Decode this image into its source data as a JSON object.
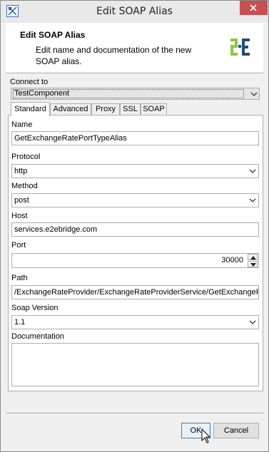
{
  "window": {
    "title": "Edit SOAP Alias",
    "icons": {
      "app": "app-icon",
      "close": "close-icon"
    },
    "close_color": "#c75050"
  },
  "header": {
    "title": "Edit SOAP Alias",
    "description": "Edit name and documentation of the new SOAP alias.",
    "logo": "e2e-logo-icon"
  },
  "connect": {
    "label": "Connect to",
    "value": "TestComponent"
  },
  "tabs": [
    {
      "label": "Standard",
      "active": true
    },
    {
      "label": "Advanced",
      "active": false
    },
    {
      "label": "Proxy",
      "active": false
    },
    {
      "label": "SSL",
      "active": false
    },
    {
      "label": "SOAP",
      "active": false
    }
  ],
  "form": {
    "name_label": "Name",
    "name_value": "GetExchangeRatePortTypeAlias",
    "protocol_label": "Protocol",
    "protocol_value": "http",
    "method_label": "Method",
    "method_value": "post",
    "host_label": "Host",
    "host_value": "services.e2ebridge.com",
    "port_label": "Port",
    "port_value": "30000",
    "path_label": "Path",
    "path_value": "/ExchangeRateProvider/ExchangeRateProviderService/GetExchangeRa",
    "soap_version_label": "Soap Version",
    "soap_version_value": "1.1",
    "documentation_label": "Documentation",
    "documentation_value": ""
  },
  "buttons": {
    "ok": "OK",
    "cancel": "Cancel"
  },
  "colors": {
    "ok_border": "#3c7fb1",
    "logo_green": "#8dc63f",
    "logo_blue": "#1f4e79"
  }
}
